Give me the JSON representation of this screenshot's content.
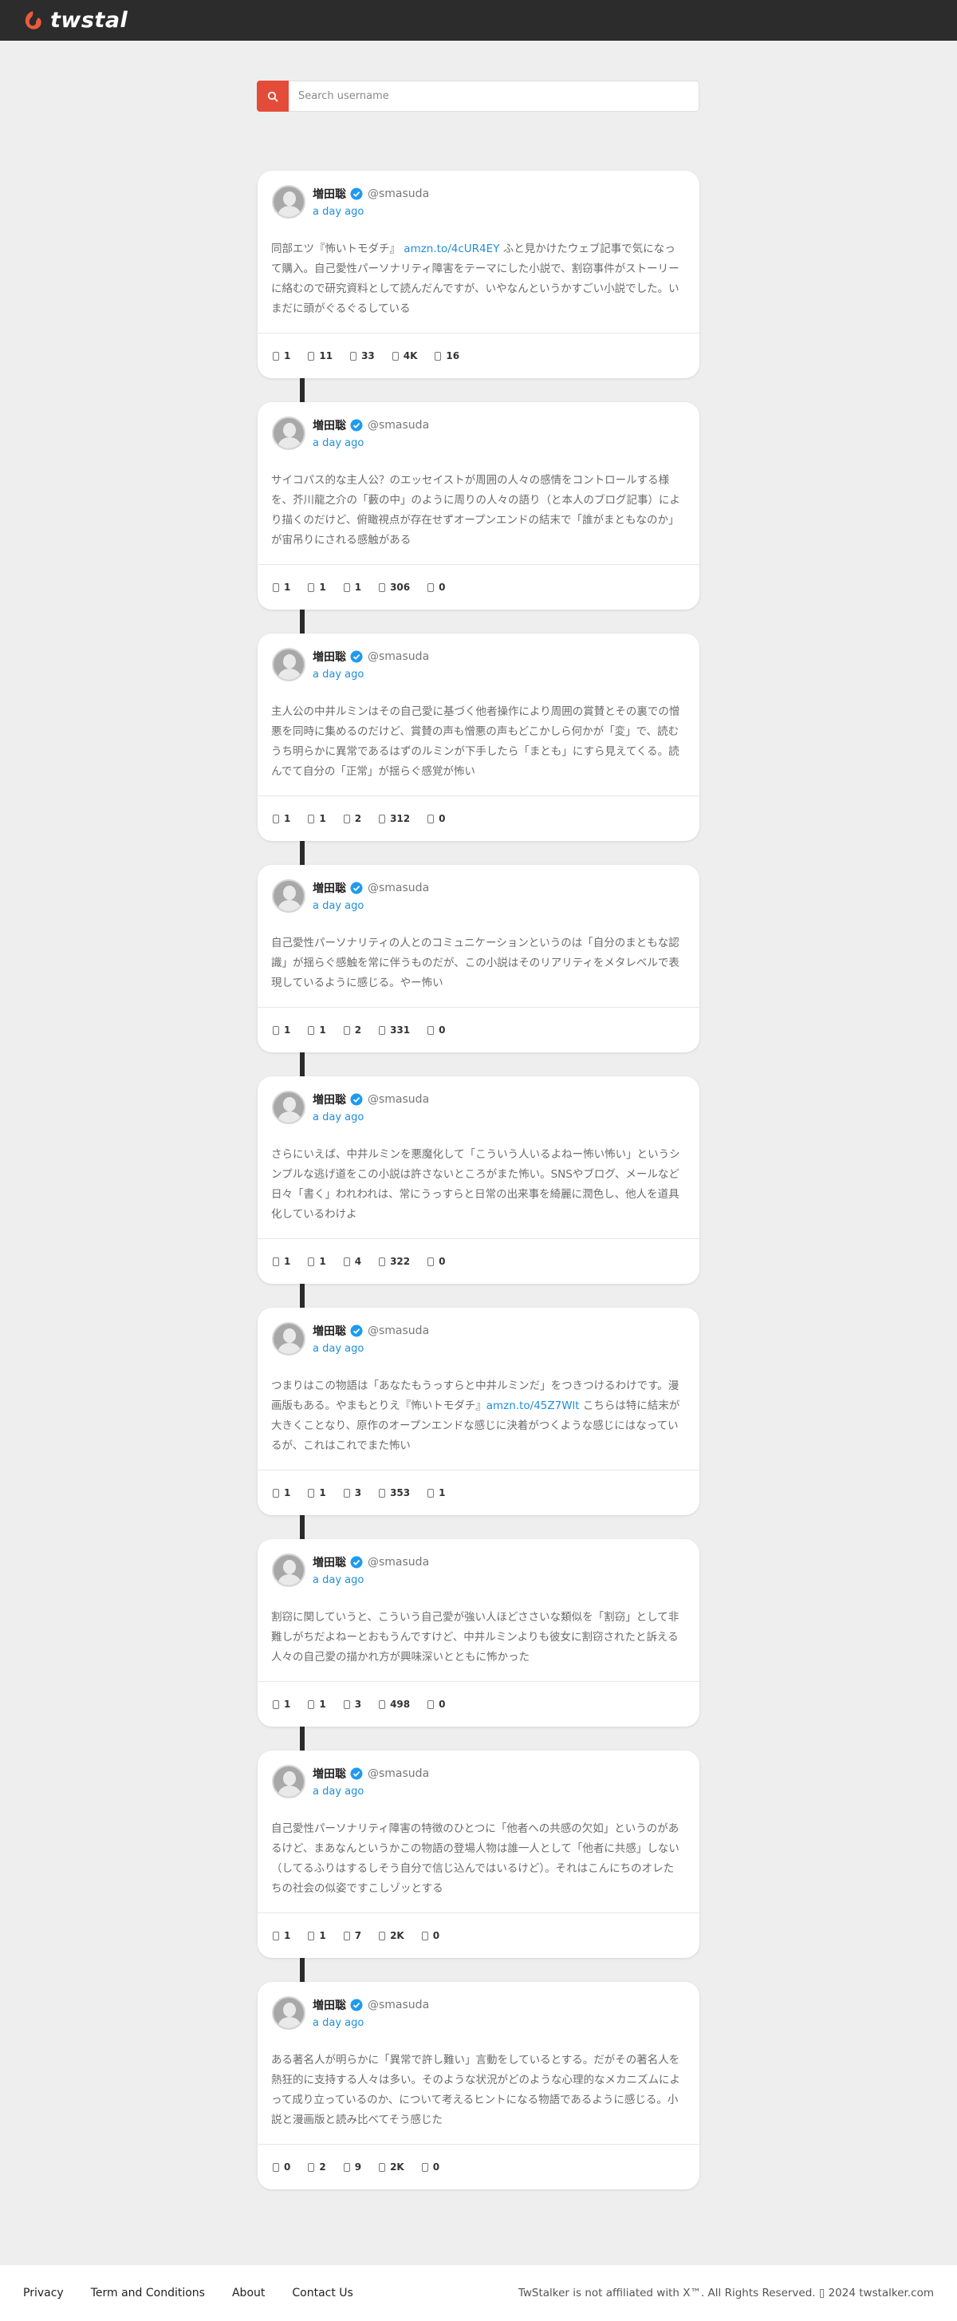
{
  "header": {
    "logo_text": "twstal"
  },
  "search": {
    "placeholder": "Search username",
    "icon": "search-icon"
  },
  "colors": {
    "accent": "#e44c3a",
    "link": "#1f8ed9",
    "verified": "#1d9bf0",
    "topbar": "#2c2c2c"
  },
  "tweets": [
    {
      "name": "増田聡",
      "handle": "@smasuda",
      "time": "a day ago",
      "text_pre": "同部エツ『怖いトモダチ』 ",
      "link": "amzn.to/4cUR4EY",
      "text_post": " ふと見かけたウェブ記事で気になって購入。自己愛性パーソナリティ障害をテーマにした小説で、割窃事件がストーリーに絡むので研究資料として読んだんですが、いやなんというかすごい小説でした。いまだに頭がぐるぐるしている",
      "stats": [
        "1",
        "11",
        "33",
        "4K",
        "16"
      ]
    },
    {
      "name": "増田聡",
      "handle": "@smasuda",
      "time": "a day ago",
      "text_pre": "サイコパス的な主人公？のエッセイストが周囲の人々の感情をコントロールする様を、芥川龍之介の「藪の中」のように周りの人々の語り（と本人のブログ記事）により描くのだけど、俯瞰視点が存在せずオープンエンドの結末で「誰がまともなのか」が宙吊りにされる感触がある",
      "link": "",
      "text_post": "",
      "stats": [
        "1",
        "1",
        "1",
        "306",
        "0"
      ]
    },
    {
      "name": "増田聡",
      "handle": "@smasuda",
      "time": "a day ago",
      "text_pre": "主人公の中井ルミンはその自己愛に基づく他者操作により周囲の賞賛とその裏での憎悪を同時に集めるのだけど、賞賛の声も憎悪の声もどこかしら何かが「変」で、読むうち明らかに異常であるはずのルミンが下手したら「まとも」にすら見えてくる。読んでて自分の「正常」が揺らぐ感覚が怖い",
      "link": "",
      "text_post": "",
      "stats": [
        "1",
        "1",
        "2",
        "312",
        "0"
      ]
    },
    {
      "name": "増田聡",
      "handle": "@smasuda",
      "time": "a day ago",
      "text_pre": "自己愛性パーソナリティの人とのコミュニケーションというのは「自分のまともな認識」が揺らぐ感触を常に伴うものだが、この小説はそのリアリティをメタレベルで表現しているように感じる。やー怖い",
      "link": "",
      "text_post": "",
      "stats": [
        "1",
        "1",
        "2",
        "331",
        "0"
      ]
    },
    {
      "name": "増田聡",
      "handle": "@smasuda",
      "time": "a day ago",
      "text_pre": "さらにいえば、中井ルミンを悪魔化して「こういう人いるよねー怖い怖い」というシンプルな逃げ道をこの小説は許さないところがまた怖い。SNSやブログ、メールなど日々「書く」われわれは、常にうっすらと日常の出来事を綺麗に潤色し、他人を道具化しているわけよ",
      "link": "",
      "text_post": "",
      "stats": [
        "1",
        "1",
        "4",
        "322",
        "0"
      ]
    },
    {
      "name": "増田聡",
      "handle": "@smasuda",
      "time": "a day ago",
      "text_pre": "つまりはこの物語は「あなたもうっすらと中井ルミンだ」をつきつけるわけです。漫画版もある。やまもとりえ『怖いトモダチ』",
      "link": "amzn.to/45Z7Wlt",
      "text_post": " こちらは特に結末が大きくことなり、原作のオープンエンドな感じに決着がつくような感じにはなっているが、これはこれでまた怖い",
      "stats": [
        "1",
        "1",
        "3",
        "353",
        "1"
      ]
    },
    {
      "name": "増田聡",
      "handle": "@smasuda",
      "time": "a day ago",
      "text_pre": "割窃に関していうと、こういう自己愛が強い人ほどささいな類似を「割窃」として非難しがちだよねーとおもうんですけど、中井ルミンよりも彼女に割窃されたと訴える人々の自己愛の描かれ方が興味深いとともに怖かった",
      "link": "",
      "text_post": "",
      "stats": [
        "1",
        "1",
        "3",
        "498",
        "0"
      ]
    },
    {
      "name": "増田聡",
      "handle": "@smasuda",
      "time": "a day ago",
      "text_pre": "自己愛性パーソナリティ障害の特徴のひとつに「他者への共感の欠如」というのがあるけど、まあなんというかこの物語の登場人物は誰一人として「他者に共感」しない（してるふりはするしそう自分で信じ込んではいるけど）。それはこんにちのオレたちの社会の似姿ですこしゾッとする",
      "link": "",
      "text_post": "",
      "stats": [
        "1",
        "1",
        "7",
        "2K",
        "0"
      ]
    },
    {
      "name": "増田聡",
      "handle": "@smasuda",
      "time": "a day ago",
      "text_pre": "ある著名人が明らかに「異常で許し難い」言動をしているとする。だがその著名人を熱狂的に支持する人々は多い。そのような状況がどのような心理的なメカニズムによって成り立っているのか、について考えるヒントになる物語であるように感じる。小説と漫画版と読み比べてそう感じた",
      "link": "",
      "text_post": "",
      "stats": [
        "0",
        "2",
        "9",
        "2K",
        "0"
      ]
    }
  ],
  "footer": {
    "links": [
      "Privacy",
      "Term and Conditions",
      "About",
      "Contact Us"
    ],
    "copyright": "TwStalker is not affiliated with X™. All Rights Reserved. ▯ 2024 twstalker.com"
  }
}
